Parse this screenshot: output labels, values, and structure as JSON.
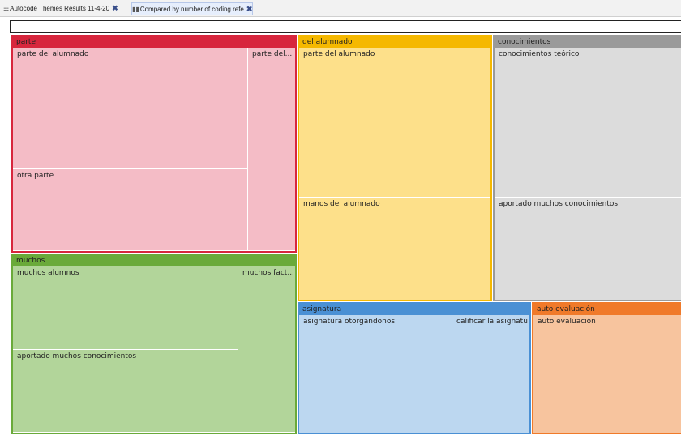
{
  "tabs": [
    {
      "icon": "☷",
      "label": "Autocode Themes Results 11-4-20",
      "close": "✖"
    },
    {
      "icon": "▮▮",
      "label": "Compared by number of coding refe",
      "close": "✖"
    }
  ],
  "colors": {
    "parte": "#d7263d",
    "parte_fill": "#f4bcc6",
    "del_alumnado": "#f5b800",
    "del_alumnado_fill": "#fde08a",
    "conocimientos": "#9a9a9a",
    "conocimientos_fill": "#dcdcdc",
    "muchos": "#6aaa3a",
    "muchos_fill": "#b2d59a",
    "asignatura": "#4a90d4",
    "asignatura_fill": "#bcd7f0",
    "auto_evaluacion": "#f07a2a",
    "auto_evaluacion_fill": "#f7c49e"
  },
  "treemap": {
    "parte": {
      "title": "parte",
      "cells": [
        "parte del alumnado",
        "otra parte",
        "parte del..."
      ]
    },
    "del_alumnado": {
      "title": "del alumnado",
      "cells": [
        "parte del alumnado",
        "manos del alumnado"
      ]
    },
    "conocimientos": {
      "title": "conocimientos",
      "cells": [
        "conocimientos teórico",
        "aportado muchos conocimientos"
      ]
    },
    "muchos": {
      "title": "muchos",
      "cells": [
        "muchos alumnos",
        "aportado muchos conocimientos",
        "muchos fact..."
      ]
    },
    "asignatura": {
      "title": "asignatura",
      "cells": [
        "asignatura otorgándonos",
        "calificar la asignatura"
      ]
    },
    "auto_evaluacion": {
      "title": "auto evaluación",
      "cells": [
        "auto evaluación"
      ]
    }
  }
}
